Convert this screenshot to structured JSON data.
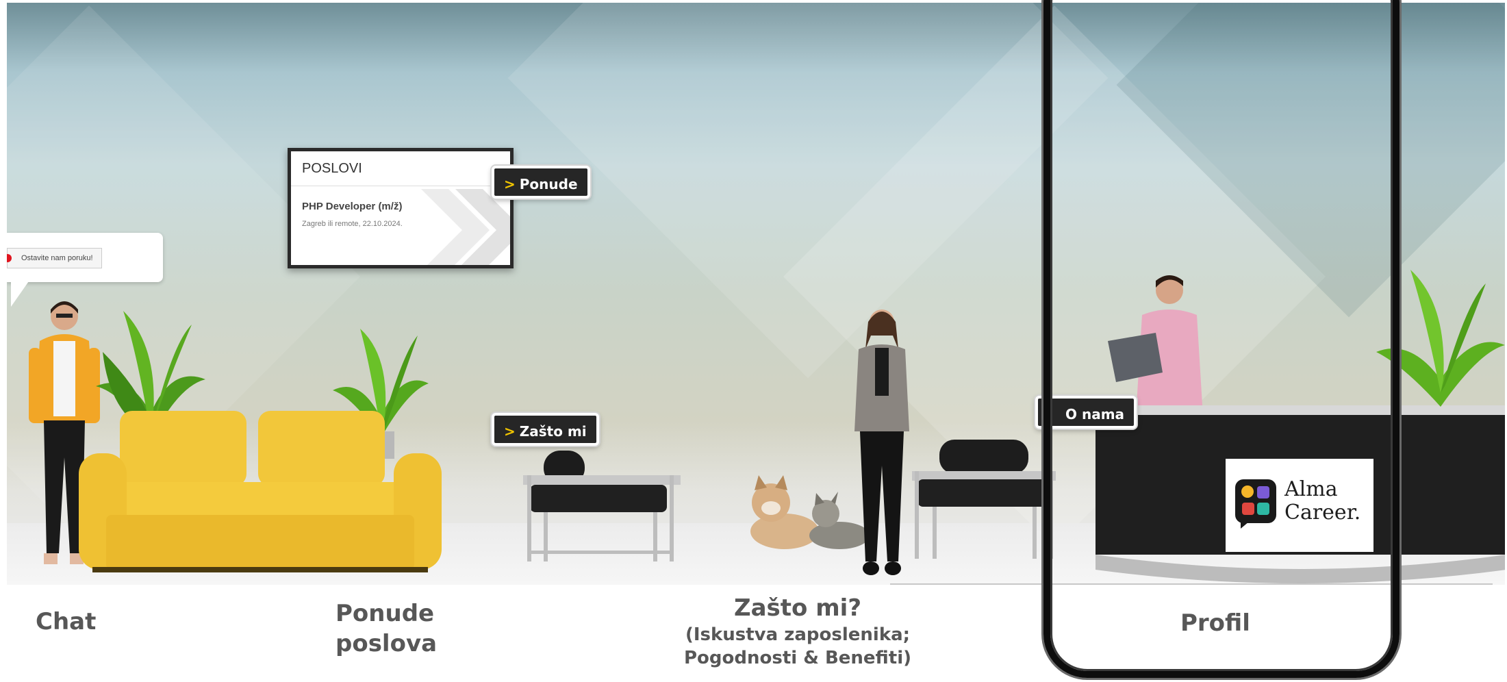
{
  "jobs_board": {
    "header": "POSLOVI",
    "job_title": "PHP Developer (m/ž)",
    "job_meta": "Zagreb ili remote, 22.10.2024."
  },
  "hotspots": {
    "ponude": "Ponude",
    "zasto_mi": "Zašto mi",
    "o_nama": "O nama",
    "chevron": ">"
  },
  "chat": {
    "message": "Ostavite nam poruku!"
  },
  "logo": {
    "line1": "Alma",
    "line2": "Career."
  },
  "captions": {
    "chat": "Chat",
    "ponude_line1": "Ponude",
    "ponude_line2": "poslova",
    "zasto_title": "Zašto mi?",
    "zasto_line1": "(Iskustva zaposlenika;",
    "zasto_line2": "Pogodnosti & Benefiti)",
    "profil": "Profil"
  },
  "colors": {
    "tag_bg": "#262626",
    "tag_chevron": "#f0c400",
    "sofa": "#f1c533",
    "desk": "#1f1f1f",
    "chat_dot": "#e0141e"
  }
}
